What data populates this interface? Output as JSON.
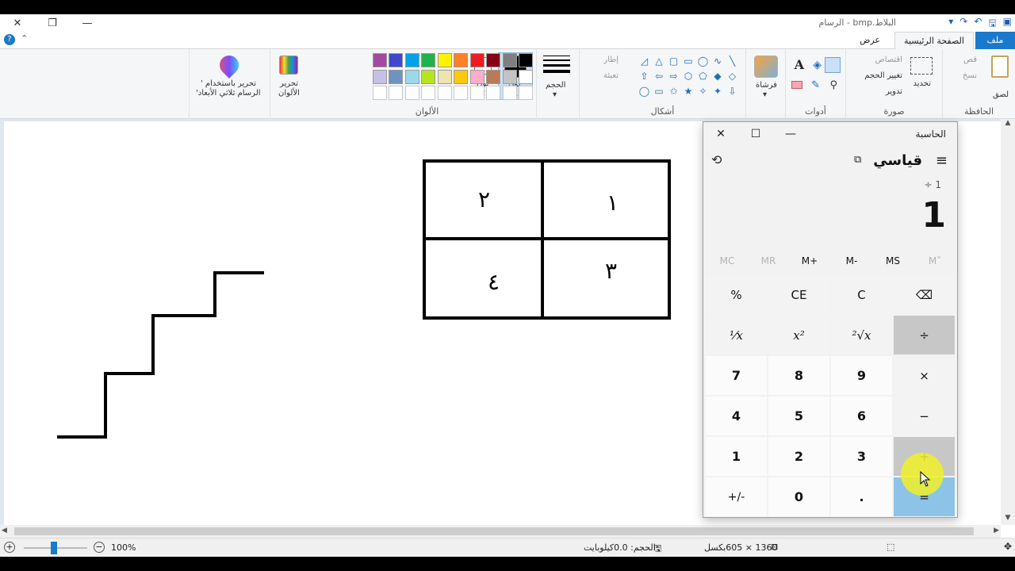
{
  "window": {
    "title": "البلاط.bmp - الرسام",
    "controls": {
      "close": "✕",
      "restore": "❐",
      "minimize": "—"
    }
  },
  "tabs": {
    "file": "ملف",
    "home": "الصفحة الرئيسية",
    "view": "عرض"
  },
  "ribbon": {
    "clipboard": {
      "label": "الحافظة",
      "paste": "لصق",
      "cut": "قص",
      "copy": "نسخ"
    },
    "image": {
      "label": "صورة",
      "select": "تحديد",
      "crop": "اقتصاص",
      "resize": "تغيير الحجم",
      "rotate": "تدوير"
    },
    "tools": {
      "label": "أدوات"
    },
    "brushes": {
      "label": "فرشاة"
    },
    "shapes": {
      "label": "أشكال",
      "outline": "إطار",
      "fill": "تعبئة"
    },
    "size": {
      "label": "الحجم"
    },
    "color1": {
      "label": "لون",
      "num": "1"
    },
    "color2": {
      "label": "لون",
      "num": "2"
    },
    "colors": {
      "label": "الألوان"
    },
    "edit_colors": {
      "line1": "تحرير",
      "line2": "الألوان"
    },
    "paint3d": {
      "line1": "تحرير باستخدام '",
      "line2": "الرسام ثلاثي الأبعاد'"
    }
  },
  "palette_row1": [
    "#000000",
    "#7f7f7f",
    "#880015",
    "#ed1c24",
    "#ff7f27",
    "#fff200",
    "#22b14c",
    "#00a2e8",
    "#3f48cc",
    "#a349a4"
  ],
  "palette_row2": [
    "#ffffff",
    "#c3c3c3",
    "#b97a57",
    "#ffaec9",
    "#ffc90e",
    "#efe4b0",
    "#b5e61d",
    "#99d9ea",
    "#7092be",
    "#c8bfe7"
  ],
  "canvas_text": {
    "c1": "١",
    "c2": "٢",
    "c3": "٣",
    "c4": "٤"
  },
  "calculator": {
    "title": "الحاسبة",
    "mode": "قياسي",
    "expression": "÷ 1",
    "display": "1",
    "memory": [
      "MC",
      "MR",
      "M+",
      "M-",
      "MS",
      "M˅"
    ],
    "keys": {
      "percent": "%",
      "ce": "CE",
      "c": "C",
      "backspace": "⌫",
      "reciprocal": "¹⁄x",
      "square": "x²",
      "sqrt": "²√x",
      "divide": "÷",
      "n7": "7",
      "n8": "8",
      "n9": "9",
      "multiply": "×",
      "n4": "4",
      "n5": "5",
      "n6": "6",
      "minus": "−",
      "n1": "1",
      "n2": "2",
      "n3": "3",
      "plus": "+",
      "negate": "+/-",
      "n0": "0",
      "dot": ".",
      "equals": "="
    }
  },
  "status": {
    "dimensions": "1360 × 605بكسل",
    "size": "الحجم: 0.0كيلوبايت",
    "zoom": "100%"
  }
}
